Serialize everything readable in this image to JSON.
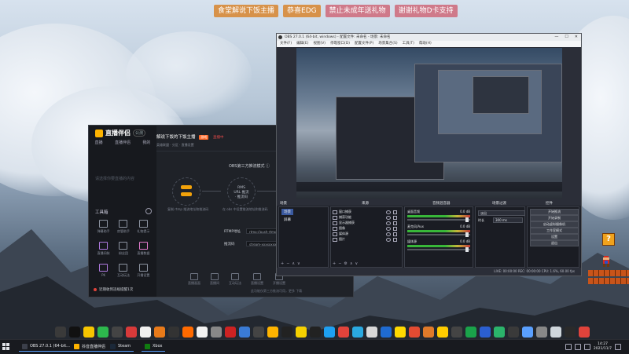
{
  "banner": {
    "tags": [
      {
        "text": "食堂解说下饭主播",
        "color": "#e0a24a"
      },
      {
        "text": "恭喜EDG",
        "color": "#e0a24a"
      },
      {
        "text": "禁止未成年送礼物",
        "color": "#d8828f"
      },
      {
        "text": "谢谢礼物D卡支持",
        "color": "#d8828f"
      }
    ]
  },
  "desktop": {
    "qblock_label": "?"
  },
  "app": {
    "logo": "直播伴侣",
    "version": "公测",
    "nav": [
      "直播",
      "直播伴侣",
      "我的"
    ],
    "side_hint": "请选择你要直播的内容",
    "tools_label": "工具箱",
    "tools": [
      "弹幕助手",
      "房管助手",
      "礼物提示",
      "直播间装",
      "粉丝团",
      "直播数据",
      "PK",
      "互动玩法",
      "开播设置"
    ],
    "notice": "近期收到违规提醒1次",
    "room_title": "解说下饭的下饭主播",
    "room_tag": "游戏",
    "room_status": "直播中",
    "room_sub": "英雄联盟 · 分区 · 直播设置",
    "obs_help": "OBS第三方推流模式 ⓘ",
    "steps": [
      {
        "mid": "",
        "label": "复制 rtmp 推流地址和推流码"
      },
      {
        "mid": "RMS URL\n推流 · 推流码",
        "label": "在 obs 中设置推流地址和推流码"
      },
      {
        "mid": "",
        "label": "在 OBS 开始推流"
      }
    ],
    "rtmp_label": "RTMP地址",
    "rtmp_value": "rtmp://push-rtmp-l1.douyincdn.com/third",
    "key_label": "推流码",
    "key_value": "stream-xxxxxxxxxxxxxxxx",
    "footer_items": [
      "直播画面",
      "直播间",
      "互动玩法",
      "直播设置",
      "开播设置"
    ],
    "footer_note": "此功能仅第三方推流可用，更多 下载"
  },
  "obs": {
    "title": "OBS 27.0.1 (64-bit, windows) - 配置文件: 未命名 - 场景: 未命名",
    "menu": [
      "文件(F)",
      "编辑(E)",
      "视图(V)",
      "停靠窗口(D)",
      "配置文件(P)",
      "场景集合(S)",
      "工具(T)",
      "帮助(H)"
    ],
    "panel_titles": {
      "scenes": "场景",
      "sources": "来源",
      "mixer": "音频混音器",
      "transitions": "场景过渡",
      "controls": "控件"
    },
    "scene_names": [
      "场景",
      "屏幕"
    ],
    "sources": [
      "窗口捕获",
      "捕获功能",
      "显示器捕获",
      "图像",
      "媒体源",
      "图片"
    ],
    "mixer": [
      {
        "name": "桌面音频",
        "level": "0.0 dB"
      },
      {
        "name": "麦克风/Aux",
        "level": "0.0 dB"
      },
      {
        "name": "媒体源",
        "level": "0.0 dB"
      }
    ],
    "transition_label": "淡出",
    "transition_value": "淡出",
    "duration_label": "时长",
    "duration_value": "300 ms",
    "controls": [
      "开始推流",
      "开始录制",
      "启动虚拟摄像机",
      "工作室模式",
      "设置",
      "退出"
    ],
    "status": "LIVE: 00:00:00   REC: 00:00:00   CPU: 1.6%, 60.00 fps"
  },
  "taskbar": {
    "items": [
      {
        "label": "OBS 27.0.1 (64-bit...",
        "color": "#3b3f4a"
      },
      {
        "label": "抖音直播伴侣",
        "color": "#ffb400"
      },
      {
        "label": "Steam",
        "color": "#1b2838"
      },
      {
        "label": "Xbox",
        "color": "#107c10"
      }
    ],
    "time": "14:27",
    "date": "2021/11/7"
  },
  "dock_colors": [
    "#3a3a3a",
    "#111",
    "#f7c600",
    "#2db84d",
    "#444",
    "#d83a3a",
    "#f0f0f0",
    "#e87a1a",
    "#333",
    "#ff6a00",
    "#f2f2f2",
    "#888",
    "#cc2222",
    "#3a7bd5",
    "#444",
    "#ffb400",
    "#222",
    "#f5d000",
    "#222",
    "#1ea0f2",
    "#e0433b",
    "#2aa9e0",
    "#d8d8d8",
    "#1f6bd1",
    "#ffd900",
    "#e34b32",
    "#e07a2a",
    "#ffcc00",
    "#444",
    "#1aa34a",
    "#2b5fd1",
    "#2bb46b",
    "#3a3a3a",
    "#5aa0ff",
    "#888",
    "#cfd6dc",
    "#2a2a2a",
    "#e0433b"
  ]
}
